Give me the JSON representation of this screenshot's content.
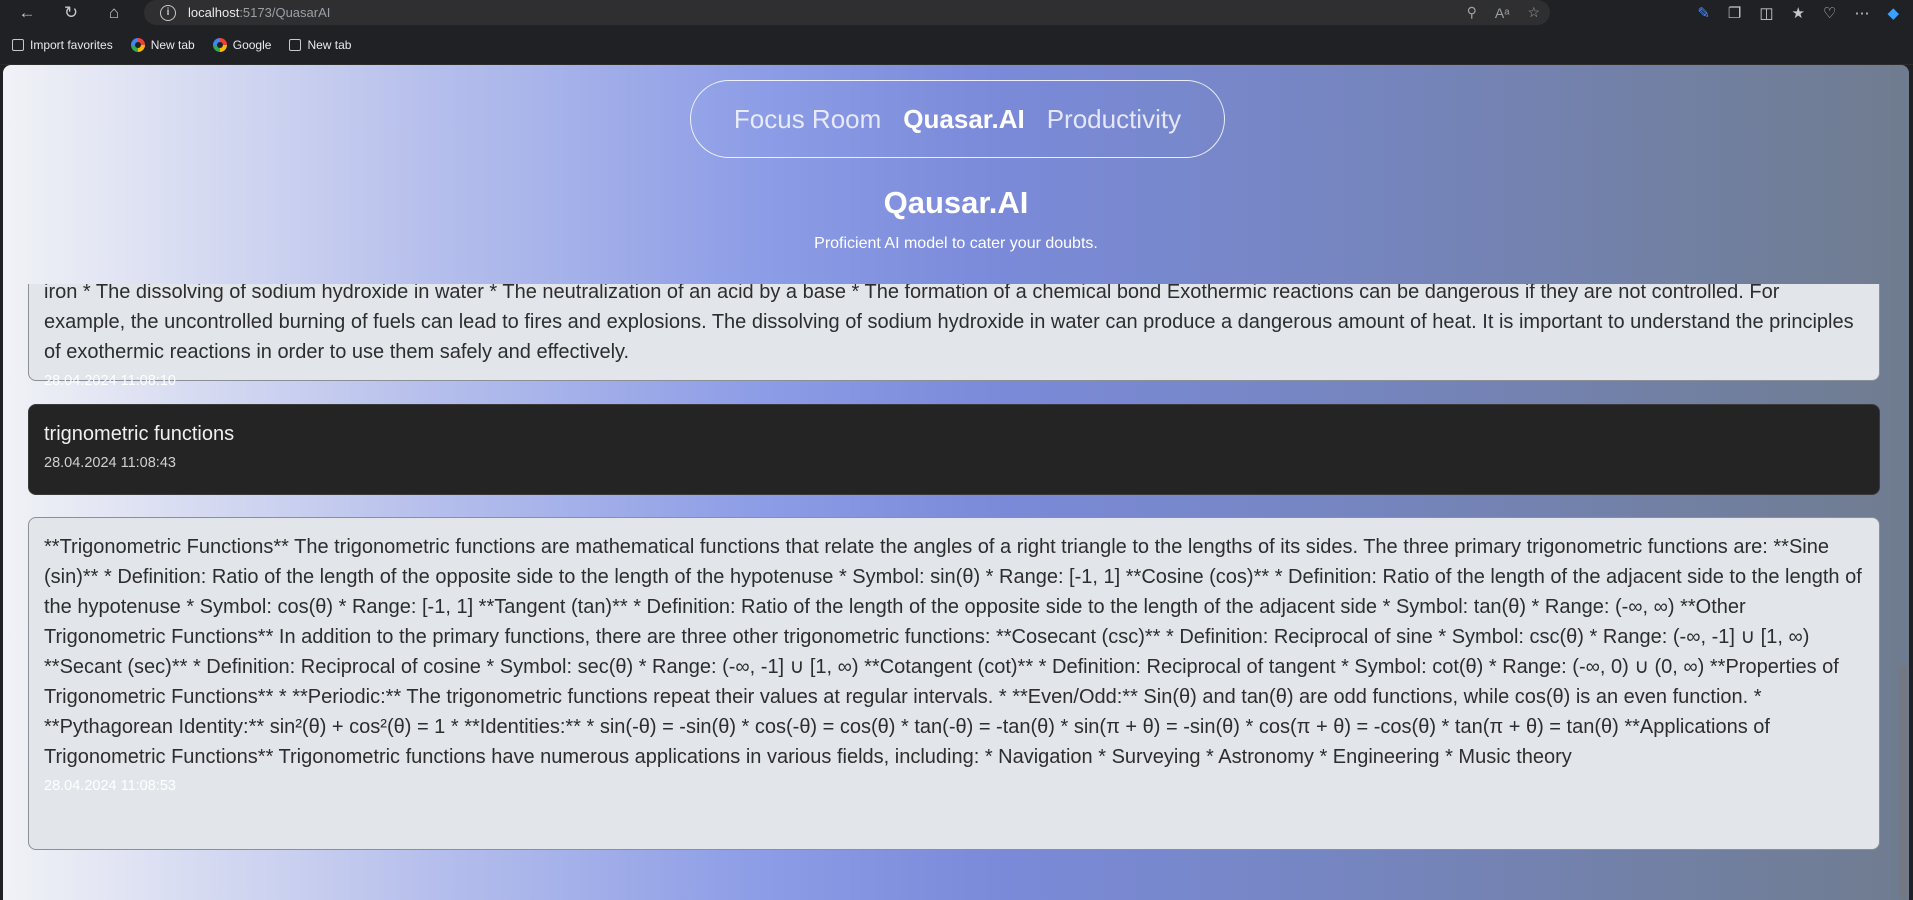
{
  "browser": {
    "url_host": "localhost",
    "url_path": ":5173/QuasarAI",
    "bookmarks": [
      {
        "label": "Import favorites"
      },
      {
        "label": "New tab"
      },
      {
        "label": "Google"
      },
      {
        "label": "New tab"
      }
    ]
  },
  "nav": {
    "items": [
      {
        "label": "Focus Room",
        "active": false
      },
      {
        "label": "Quasar.AI",
        "active": true
      },
      {
        "label": "Productivity",
        "active": false
      }
    ]
  },
  "header": {
    "title": "Qausar.AI",
    "subtitle": "Proficient AI model to cater your doubts."
  },
  "messages": [
    {
      "role": "ai",
      "text": "iron * The dissolving of sodium hydroxide in water * The neutralization of an acid by a base * The formation of a chemical bond Exothermic reactions can be dangerous if they are not controlled. For example, the uncontrolled burning of fuels can lead to fires and explosions. The dissolving of sodium hydroxide in water can produce a dangerous amount of heat. It is important to understand the principles of exothermic reactions in order to use them safely and effectively.",
      "timestamp": "28.04.2024 11:08:10"
    },
    {
      "role": "user",
      "text": "trignometric functions",
      "timestamp": "28.04.2024 11:08:43"
    },
    {
      "role": "ai",
      "text": "**Trigonometric Functions** The trigonometric functions are mathematical functions that relate the angles of a right triangle to the lengths of its sides. The three primary trigonometric functions are: **Sine (sin)** * Definition: Ratio of the length of the opposite side to the length of the hypotenuse * Symbol: sin(θ) * Range: [-1, 1] **Cosine (cos)** * Definition: Ratio of the length of the adjacent side to the length of the hypotenuse * Symbol: cos(θ) * Range: [-1, 1] **Tangent (tan)** * Definition: Ratio of the length of the opposite side to the length of the adjacent side * Symbol: tan(θ) * Range: (-∞, ∞) **Other Trigonometric Functions** In addition to the primary functions, there are three other trigonometric functions: **Cosecant (csc)** * Definition: Reciprocal of sine * Symbol: csc(θ) * Range: (-∞, -1] ∪ [1, ∞) **Secant (sec)** * Definition: Reciprocal of cosine * Symbol: sec(θ) * Range: (-∞, -1] ∪ [1, ∞) **Cotangent (cot)** * Definition: Reciprocal of tangent * Symbol: cot(θ) * Range: (-∞, 0) ∪ (0, ∞) **Properties of Trigonometric Functions** * **Periodic:** The trigonometric functions repeat their values at regular intervals. * **Even/Odd:** Sin(θ) and tan(θ) are odd functions, while cos(θ) is an even function. * **Pythagorean Identity:** sin²(θ) + cos²(θ) = 1 * **Identities:** * sin(-θ) = -sin(θ) * cos(-θ) = cos(θ) * tan(-θ) = -tan(θ) * sin(π + θ) = -sin(θ) * cos(π + θ) = -cos(θ) * tan(π + θ) = tan(θ) **Applications of Trigonometric Functions** Trigonometric functions have numerous applications in various fields, including: * Navigation * Surveying * Astronomy * Engineering * Music theory",
      "timestamp": "28.04.2024 11:08:53"
    }
  ]
}
